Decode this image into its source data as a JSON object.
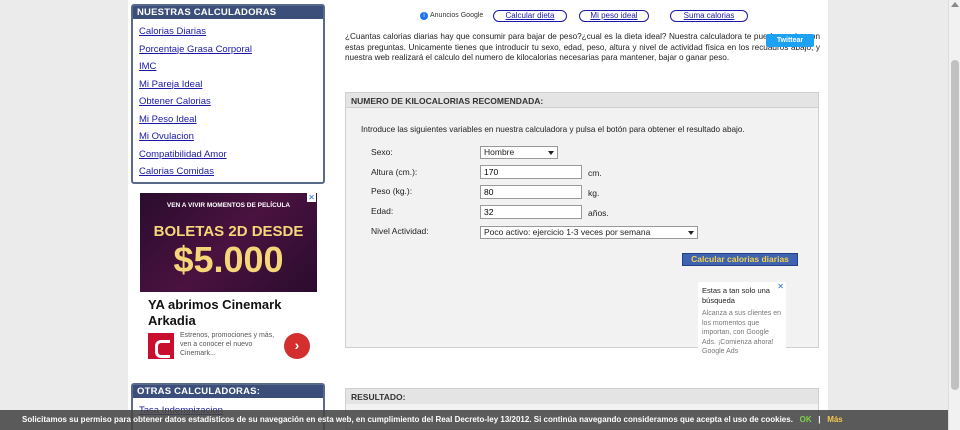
{
  "sidebar": {
    "title": "NUESTRAS CALCULADORAS",
    "items": [
      {
        "label": "Calorias Diarias"
      },
      {
        "label": "Porcentaje Grasa Corporal"
      },
      {
        "label": "IMC"
      },
      {
        "label": "Mi Pareja Ideal"
      },
      {
        "label": "Obtener Calorias"
      },
      {
        "label": "Mi Peso Ideal"
      },
      {
        "label": "Mi Ovulacion"
      },
      {
        "label": "Compatibilidad Amor"
      },
      {
        "label": "Calorias Comidas"
      }
    ]
  },
  "other_sidebar": {
    "title": "OTRAS CALCULADORAS:",
    "items": [
      {
        "label": "Tasa Indemnizacion"
      }
    ]
  },
  "left_ad": {
    "line1": "VEN A VIVIR MOMENTOS DE PELÍCULA",
    "line2": "BOLETAS 2D DESDE",
    "line3": "$5.000",
    "title": "YA abrimos Cinemark Arkadia",
    "description": "Estrenos, promociones y más, ven a conocer el nuevo Cinemark...",
    "go_symbol": "›",
    "close_symbol": "✕"
  },
  "top_ads": {
    "label": "Anuncios Google",
    "info_symbol": "i",
    "links": [
      "Calcular dieta",
      "Mi peso ideal",
      "Suma calorias"
    ]
  },
  "intro": "¿Cuantas calorias diarias hay que consumir para bajar de peso?¿cual es la dieta ideal? Nuestra calculadora te puede ayudar con estas preguntas. Unicamente tienes que introducir tu sexo, edad, peso, altura y nivel de actividad física en los recuadros abajo, y nuestra web realizará el calculo del numero de kilocalorias necesarias para mantener, bajar o ganar peso.",
  "twitter_button": "Twittear",
  "calculator": {
    "title": "NUMERO DE KILOCALORIAS RECOMENDADA:",
    "instructions": "Introduce las siguientes variables en nuestra calculadora y pulsa el botón para obtener el resultado abajo.",
    "sexo_label": "Sexo:",
    "sexo_value": "Hombre",
    "altura_label": "Altura (cm.):",
    "altura_value": "170",
    "altura_unit": "cm.",
    "peso_label": "Peso (kg.):",
    "peso_value": "80",
    "peso_unit": "kg.",
    "edad_label": "Edad:",
    "edad_value": "32",
    "edad_unit": "años.",
    "actividad_label": "Nivel Actividad:",
    "actividad_value": "Poco activo: ejercicio 1-3 veces por semana",
    "button": "Calcular calorias diarias"
  },
  "right_ad": {
    "headline": "Estas a tan solo una búsqueda",
    "body": "Alcanza a sus clientes en los momentos que importan, con Google Ads. ¡Comienza ahora! Google Ads",
    "close_symbol": "✕"
  },
  "result": {
    "title": "RESULTADO:"
  },
  "cookie_bar": {
    "text": "Solicitamos su permiso para obtener datos estadísticos de su navegación en esta web, en cumplimiento del Real Decreto-ley 13/2012. Si continúa navegando consideramos que acepta el uso de cookies.",
    "ok": "OK",
    "separator": "|",
    "more": "Más"
  }
}
